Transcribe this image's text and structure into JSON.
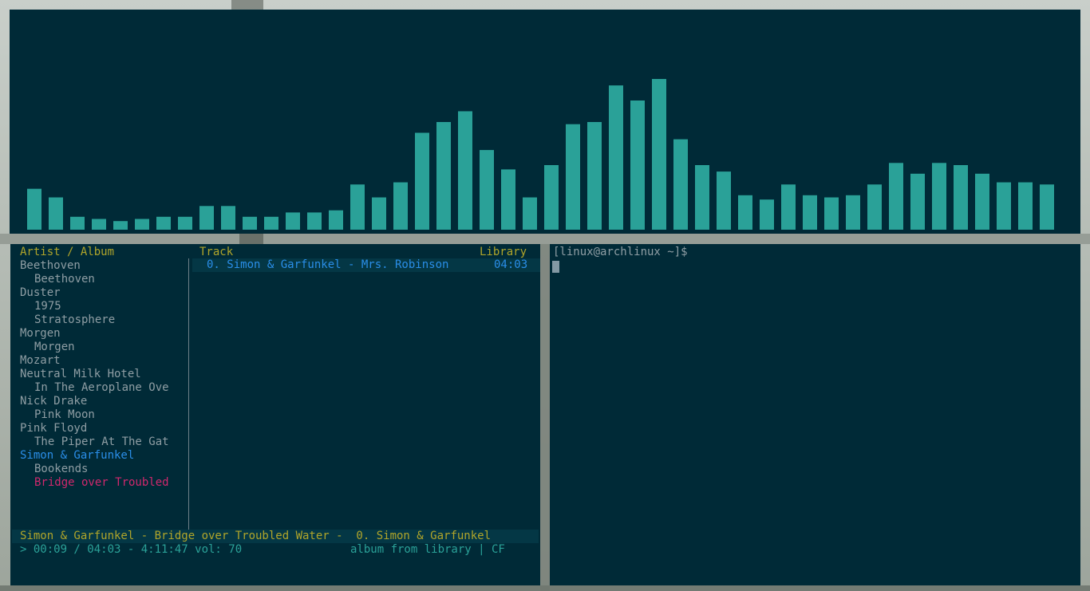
{
  "colors": {
    "pane_bg": "#002a37",
    "bar": "#2aa198",
    "header": "#b0a52a",
    "tree_text": "#8f9ea4",
    "selected": "#2a8ee8",
    "playing": "#d1286d"
  },
  "visualizer": {
    "bars": [
      0.19,
      0.15,
      0.06,
      0.05,
      0.04,
      0.05,
      0.06,
      0.06,
      0.11,
      0.11,
      0.06,
      0.06,
      0.08,
      0.08,
      0.09,
      0.21,
      0.15,
      0.22,
      0.45,
      0.5,
      0.55,
      0.37,
      0.28,
      0.15,
      0.3,
      0.49,
      0.5,
      0.67,
      0.6,
      0.7,
      0.42,
      0.3,
      0.27,
      0.16,
      0.14,
      0.21,
      0.16,
      0.15,
      0.16,
      0.21,
      0.31,
      0.26,
      0.31,
      0.3,
      0.26,
      0.22,
      0.22,
      0.21
    ]
  },
  "cmus": {
    "headers": {
      "artist_album": "Artist / Album",
      "track": "Track",
      "library": "Library"
    },
    "tree": [
      {
        "text": "Beethoven",
        "indent": false,
        "state": "normal"
      },
      {
        "text": "Beethoven",
        "indent": true,
        "state": "normal"
      },
      {
        "text": "Duster",
        "indent": false,
        "state": "normal"
      },
      {
        "text": "1975",
        "indent": true,
        "state": "normal"
      },
      {
        "text": "Stratosphere",
        "indent": true,
        "state": "normal"
      },
      {
        "text": "Morgen",
        "indent": false,
        "state": "normal"
      },
      {
        "text": "Morgen",
        "indent": true,
        "state": "normal"
      },
      {
        "text": "Mozart",
        "indent": false,
        "state": "normal"
      },
      {
        "text": "Neutral Milk Hotel",
        "indent": false,
        "state": "normal"
      },
      {
        "text": "In The Aeroplane Ove",
        "indent": true,
        "state": "normal"
      },
      {
        "text": "Nick Drake",
        "indent": false,
        "state": "normal"
      },
      {
        "text": "Pink Moon",
        "indent": true,
        "state": "normal"
      },
      {
        "text": "Pink Floyd",
        "indent": false,
        "state": "normal"
      },
      {
        "text": "The Piper At The Gat",
        "indent": true,
        "state": "normal"
      },
      {
        "text": "Simon & Garfunkel",
        "indent": false,
        "state": "selected"
      },
      {
        "text": "Bookends",
        "indent": true,
        "state": "normal"
      },
      {
        "text": "Bridge over Troubled",
        "indent": true,
        "state": "playing"
      }
    ],
    "tracks": [
      {
        "label": "0. Simon & Garfunkel - Mrs. Robinson",
        "duration": "04:03"
      }
    ],
    "status": {
      "now_playing": "Simon & Garfunkel - Bridge over Troubled Water -  0. Simon & Garfunkel",
      "position": "> 00:09 / 04:03 - 4:11:47 vol: 70",
      "mode": "album from library | CF"
    }
  },
  "terminal": {
    "prompt": "[linux@archlinux ~]$"
  }
}
